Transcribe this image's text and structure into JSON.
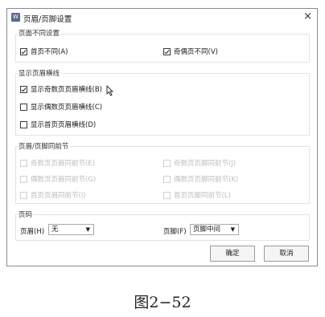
{
  "dialog": {
    "title": "页眉/页脚设置",
    "close_label": "×",
    "icon_label": "W"
  },
  "section_page_diff": {
    "legend": "页面不同设置",
    "first_page_diff": {
      "label": "首页不同(A)",
      "checked": true
    },
    "odd_even_diff": {
      "label": "奇偶页不同(V)",
      "checked": true
    }
  },
  "section_header_line": {
    "legend": "显示页眉横线",
    "items": [
      {
        "label": "显示奇数页页眉横线(B)",
        "checked": true
      },
      {
        "label": "显示偶数页页眉横线(C)",
        "checked": false
      },
      {
        "label": "显示首页页眉横线(D)",
        "checked": false
      }
    ]
  },
  "section_same_as_prev": {
    "legend": "页眉/页脚同前节",
    "left": [
      {
        "label": "奇数页页眉同前节(E)"
      },
      {
        "label": "偶数页页眉同前节(G)"
      },
      {
        "label": "首页页眉同前节(I)"
      }
    ],
    "right": [
      {
        "label": "奇数页页脚同前节(J)"
      },
      {
        "label": "偶数页页脚同前节(K)"
      },
      {
        "label": "首页页脚同前节(L)"
      }
    ]
  },
  "section_page_number": {
    "legend": "页码",
    "header_label": "页眉(H)",
    "header_value": "无",
    "footer_label": "页脚(F)",
    "footer_value": "页脚中间"
  },
  "buttons": {
    "ok": "确定",
    "cancel": "取消"
  },
  "caption": "图2−52"
}
